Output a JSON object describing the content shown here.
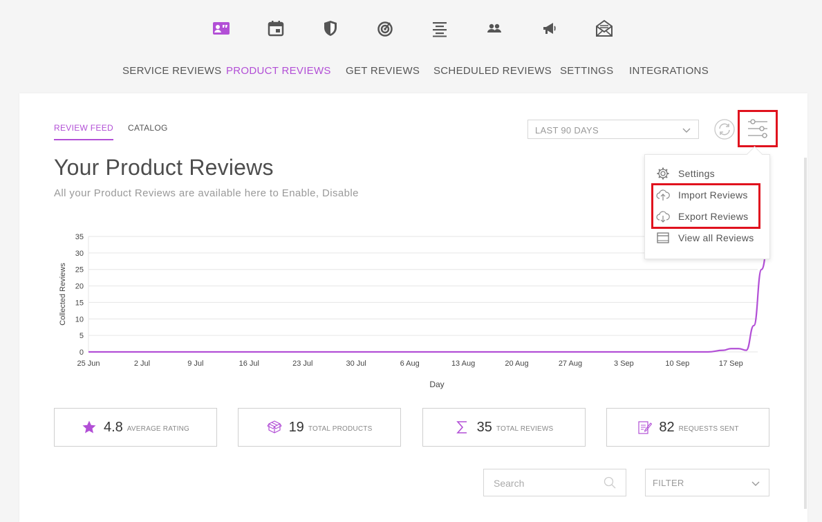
{
  "top_icons": [
    {
      "name": "contact-card-icon",
      "active": true
    },
    {
      "name": "calendar-icon",
      "active": false
    },
    {
      "name": "shield-icon",
      "active": false
    },
    {
      "name": "target-icon",
      "active": false
    },
    {
      "name": "align-center-icon",
      "active": false
    },
    {
      "name": "people-icon",
      "active": false
    },
    {
      "name": "megaphone-icon",
      "active": false
    },
    {
      "name": "envelope-icon",
      "active": false
    }
  ],
  "nav": {
    "items": [
      {
        "label": "SERVICE REVIEWS",
        "active": false
      },
      {
        "label": "PRODUCT REVIEWS",
        "active": true
      },
      {
        "label": "GET REVIEWS",
        "active": false
      },
      {
        "label": "SCHEDULED REVIEWS",
        "active": false
      },
      {
        "label": "SETTINGS",
        "active": false
      },
      {
        "label": "INTEGRATIONS",
        "active": false
      }
    ]
  },
  "subtabs": [
    {
      "label": "REVIEW FEED",
      "active": true
    },
    {
      "label": "CATALOG",
      "active": false
    }
  ],
  "toolbar": {
    "range_label": "LAST 90 DAYS",
    "refresh_icon": "refresh-icon",
    "filter_icon": "sliders-icon"
  },
  "header": {
    "title": "Your Product Reviews",
    "subtitle": "All your Product Reviews are available here to Enable, Disable"
  },
  "dropdown": {
    "items": [
      {
        "label": "Settings",
        "icon": "gear-icon"
      },
      {
        "label": "Import Reviews",
        "icon": "cloud-upload-icon"
      },
      {
        "label": "Export Reviews",
        "icon": "cloud-download-icon"
      },
      {
        "label": "View all Reviews",
        "icon": "window-icon"
      }
    ]
  },
  "colors": {
    "accent": "#b24fd6",
    "highlight": "#e0121e"
  },
  "chart_data": {
    "type": "line",
    "xlabel": "Day",
    "ylabel": "Collected Reviews",
    "ylim": [
      0,
      35
    ],
    "yticks": [
      0,
      5,
      10,
      15,
      20,
      25,
      30,
      35
    ],
    "xticks": [
      "25 Jun",
      "2 Jul",
      "9 Jul",
      "16 Jul",
      "23 Jul",
      "30 Jul",
      "6 Aug",
      "13 Aug",
      "20 Aug",
      "27 Aug",
      "3 Sep",
      "10 Sep",
      "17 Sep"
    ],
    "grid": true,
    "series": [
      {
        "x": [
          "25 Jun",
          "3 Sep",
          "10 Sep",
          "14 Sep",
          "16 Sep",
          "17 Sep",
          "18 Sep",
          "19 Sep",
          "20 Sep",
          "21 Sep",
          "22 Sep"
        ],
        "values": [
          0,
          0,
          0,
          0,
          0.5,
          1,
          1,
          0.5,
          8,
          25,
          35
        ]
      }
    ]
  },
  "stats": [
    {
      "icon": "star-icon",
      "value": "4.8",
      "label": "AVERAGE RATING"
    },
    {
      "icon": "box-icon",
      "value": "19",
      "label": "TOTAL PRODUCTS"
    },
    {
      "icon": "sigma-icon",
      "value": "35",
      "label": "TOTAL REVIEWS"
    },
    {
      "icon": "request-icon",
      "value": "82",
      "label": "REQUESTS SENT"
    }
  ],
  "search": {
    "placeholder": "Search"
  },
  "filter": {
    "label": "FILTER"
  }
}
